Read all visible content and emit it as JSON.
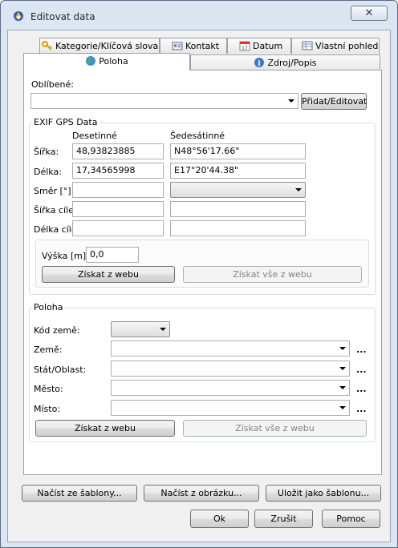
{
  "window": {
    "title": "Editovat data",
    "close_symbol": "✕"
  },
  "tabs_row1": [
    {
      "label": "Kategorie/Klíčová slova",
      "icon": "key-icon"
    },
    {
      "label": "Kontakt",
      "icon": "contact-card-icon"
    },
    {
      "label": "Datum",
      "icon": "calendar-icon"
    },
    {
      "label": "Vlastní pohled",
      "icon": "custom-view-icon"
    }
  ],
  "tabs_row2": [
    {
      "label": "Poloha",
      "icon": "globe-icon",
      "active": true
    },
    {
      "label": "Zdroj/Popis",
      "icon": "info-icon",
      "active": false
    }
  ],
  "favorites": {
    "label": "Oblíbené:",
    "value": "",
    "add_edit_button": "Přidat/Editovat"
  },
  "exif": {
    "title": "EXIF GPS Data",
    "col_decimal": "Desetinné",
    "col_sexagesimal": "Šedesátinné",
    "latitude_label": "Šířka:",
    "latitude_decimal": "48,93823885",
    "latitude_sexagesimal": "N48°56'17.66\"",
    "longitude_label": "Délka:",
    "longitude_decimal": "17,34565998",
    "longitude_sexagesimal": "E17°20'44.38\"",
    "direction_label": "Směr [°]:",
    "direction_value": "",
    "dest_latitude_label": "Šířka cíle:",
    "dest_longitude_label": "Délka cíle:",
    "altitude_label": "Výška [m]:",
    "altitude_value": "0,0",
    "get_from_web": "Získat z webu",
    "get_all_from_web": "Získat vše z webu"
  },
  "location": {
    "title": "Poloha",
    "country_code_label": "Kód země:",
    "country_label": "Země:",
    "state_label": "Stát/Oblast:",
    "city_label": "Město:",
    "place_label": "Místo:",
    "ellipsis": "...",
    "get_from_web": "Získat z webu",
    "get_all_from_web": "Získat vše z webu"
  },
  "template_buttons": {
    "load_template": "Načíst ze šablony...",
    "load_from_image": "Načíst z obrázku...",
    "save_as_template": "Uložit jako šablonu..."
  },
  "dialog_buttons": {
    "ok": "Ok",
    "cancel": "Zrušit",
    "help": "Pomoc"
  },
  "colors": {
    "title_bar": "#dce6f2",
    "client_bg": "#f0f0f0",
    "accent_border": "#9aa6b8"
  }
}
